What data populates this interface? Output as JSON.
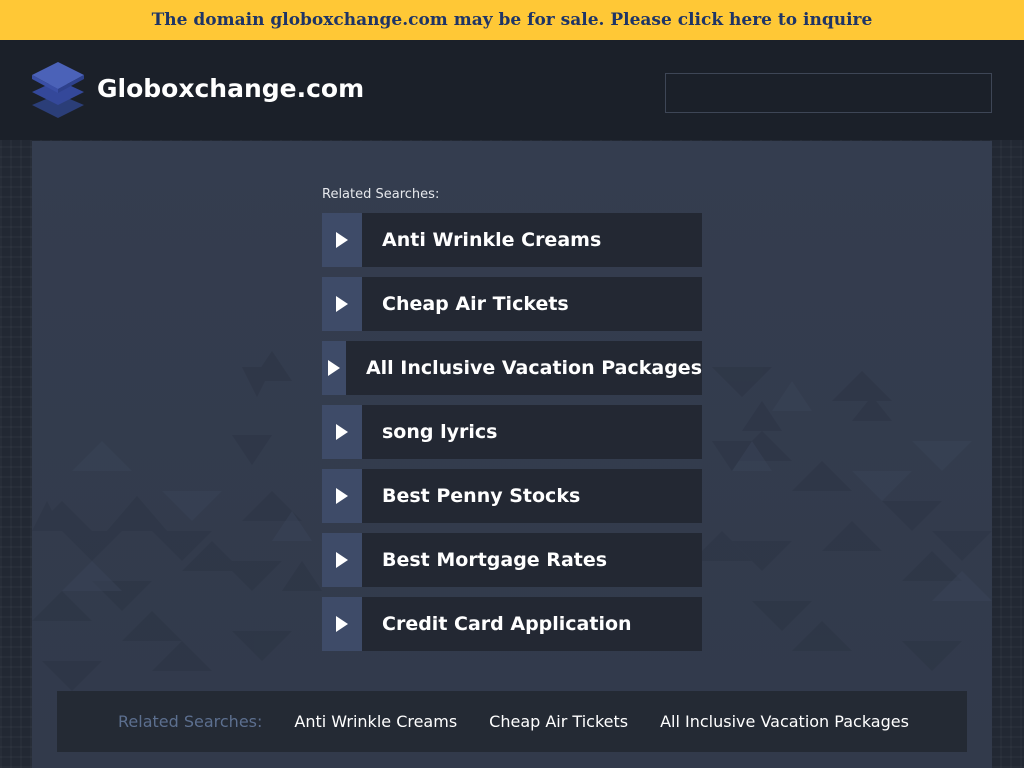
{
  "banner": {
    "text": "The domain globoxchange.com may be for sale. Please click here to inquire"
  },
  "header": {
    "site_title": "Globoxchange.com",
    "logo_icon": "stacked-layers-icon",
    "search_placeholder": ""
  },
  "main": {
    "related_label": "Related Searches:",
    "arrow_icon": "play-arrow-icon",
    "links": [
      "Anti Wrinkle Creams",
      "Cheap Air Tickets",
      "All Inclusive Vacation Packages",
      "song lyrics",
      "Best Penny Stocks",
      "Best Mortgage Rates",
      "Credit Card Application"
    ]
  },
  "footer": {
    "label": "Related Searches:",
    "links": [
      "Anti Wrinkle Creams",
      "Cheap Air Tickets",
      "All Inclusive Vacation Packages"
    ]
  },
  "colors": {
    "banner_bg": "#ffc836",
    "banner_text": "#1f3566",
    "header_bg": "#1b2029",
    "main_bg": "#343d4f",
    "arrow_bg": "#3e4b68",
    "link_bg": "#232833",
    "footer_label": "#5c6f8f"
  }
}
